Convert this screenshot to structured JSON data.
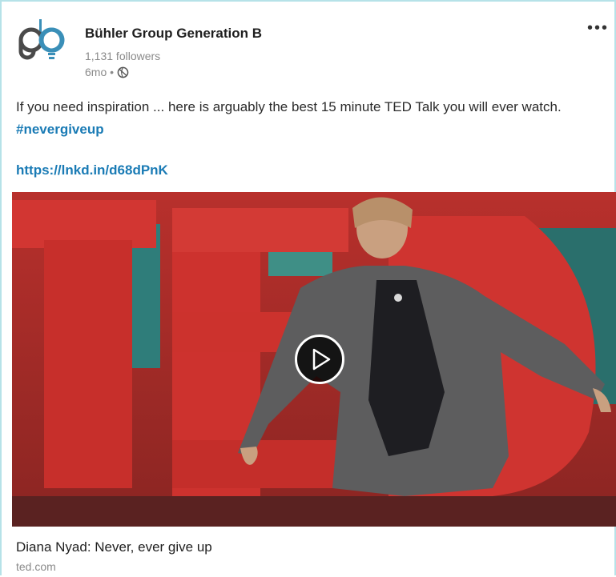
{
  "post": {
    "author": "Bühler Group Generation B",
    "followers": "1,131 followers",
    "age": "6mo •",
    "body_text": "If you need inspiration ... here is arguably the best 15 minute TED Talk you will ever watch. ",
    "hashtag": "#nevergiveup",
    "link": "https://lnkd.in/d68dPnK",
    "more_label": "•••"
  },
  "media": {
    "title": "Diana Nyad: Never, ever give up",
    "source": "ted.com"
  },
  "icons": {
    "logo": "company-logo-icon",
    "visibility": "globe-icon",
    "more": "more-options-icon",
    "play": "play-icon"
  },
  "colors": {
    "border": "#b6e2e8",
    "link": "#1a7bb5",
    "ted_red": "#c62a27"
  }
}
